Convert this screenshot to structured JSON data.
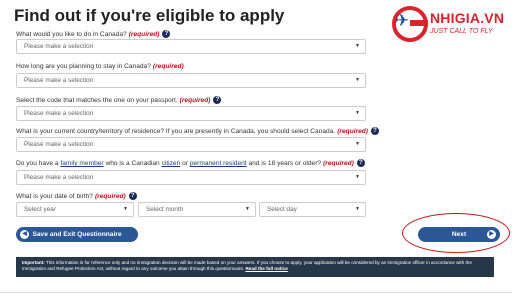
{
  "page": {
    "title": "Find out if you're eligible to apply"
  },
  "logo": {
    "name": "NHIGIA.VN",
    "tagline": "JUST CALL TO FLY",
    "brand_color": "#d9232e"
  },
  "required_label": "(required)",
  "placeholder": "Please make a selection",
  "questions": {
    "q1": {
      "label": "What would you like to do in Canada?",
      "value": "Please make a selection"
    },
    "q2": {
      "label": "How long are you planning to stay in Canada?",
      "value": "Please make a selection"
    },
    "q3": {
      "label": "Select the code that matches the one on your passport.",
      "value": "Please make a selection"
    },
    "q4": {
      "label": "What is your current country/territory of residence? If you are presently in Canada, you should select Canada.",
      "value": "Please make a selection"
    },
    "q5": {
      "label_part1": "Do you have a",
      "link1": "family member",
      "label_part2": "who is a Canadian",
      "link2": "citizen",
      "label_part3": "or",
      "link3": "permanent resident",
      "label_part4": "and is 18 years or older?",
      "value": "Please make a selection"
    },
    "q6": {
      "label": "What is your date of birth?",
      "year": "Select year",
      "month": "Select month",
      "day": "Select day"
    }
  },
  "buttons": {
    "save_exit": "Save and Exit Questionnaire",
    "next": "Next",
    "accent": "#2b5797"
  },
  "notice": {
    "bold": "Important:",
    "text": "This information is for reference only and no immigration decision will be made based on your answers. If you choose to apply, your application will be considered by an immigration officer in accordance with the Immigration and Refugee Protection Act, without regard to any outcome you attain through this questionnaire.",
    "link": "Read the full notice"
  }
}
